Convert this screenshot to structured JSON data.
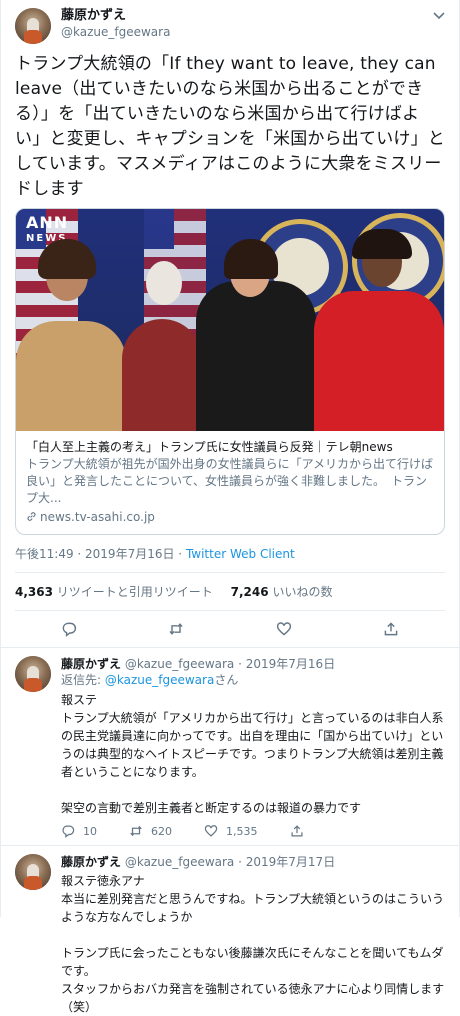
{
  "main_tweet": {
    "author_name": "藤原かずえ",
    "author_handle": "@kazue_fgeewara",
    "text": "トランプ大統領の「If they want to leave, they can leave（出ていきたいのなら米国から出ることができる）」を「出ていきたいのなら米国から出て行けばよい」と変更し、キャプションを「米国から出ていけ」としています。マスメディアはこのように大衆をミスリードします",
    "card": {
      "logo": "ANN",
      "logo_sub": "NEWS",
      "title": "「白人至上主義の考え」トランプ氏に女性議員ら反発｜テレ朝news",
      "description": "トランプ大統領が祖先が国外出身の女性議員らに「アメリカから出て行けば良い」と発言したことについて、女性議員らが強く非難しました。　トランプ大...",
      "domain": "news.tv-asahi.co.jp"
    },
    "timestamp": "午後11:49 · 2019年7月16日",
    "client": "Twitter Web Client",
    "retweets": "4,363",
    "retweets_label": "リツイートと引用リツイート",
    "likes": "7,246",
    "likes_label": "いいねの数"
  },
  "replies": [
    {
      "author_name": "藤原かずえ",
      "author_handle": "@kazue_fgeewara",
      "date": "2019年7月16日",
      "reply_to_prefix": "返信先:",
      "reply_to_handle": "@kazue_fgeewara",
      "reply_to_suffix": "さん",
      "text": "報ステ\nトランプ大統領が「アメリカから出て行け」と言っているのは非白人系の民主党議員達に向かってです。出自を理由に「国から出ていけ」というのは典型的なヘイトスピーチです。つまりトランプ大統領は差別主義者ということになります。\n\n架空の言動で差別主義者と断定するのは報道の暴力です",
      "reply_count": "10",
      "retweet_count": "620",
      "like_count": "1,535"
    },
    {
      "author_name": "藤原かずえ",
      "author_handle": "@kazue_fgeewara",
      "date": "2019年7月17日",
      "text": "報ステ徳永アナ\n本当に差別発言だと思うんですね。トランプ大統領というのはこういうような方なんでしょうか\n\nトランプ氏に会ったこともない後藤謙次氏にそんなことを聞いてもムダです。\nスタッフからおバカ発言を強制されている徳永アナに心より同情します（笑）"
    }
  ],
  "icons": {
    "reply": "reply-icon",
    "retweet": "retweet-icon",
    "like": "heart-icon",
    "share": "share-icon",
    "menu": "chevron-down-icon",
    "link": "link-icon"
  },
  "colors": {
    "link_blue": "#1b95e0",
    "muted": "#657786",
    "border": "#e6ecf0"
  }
}
